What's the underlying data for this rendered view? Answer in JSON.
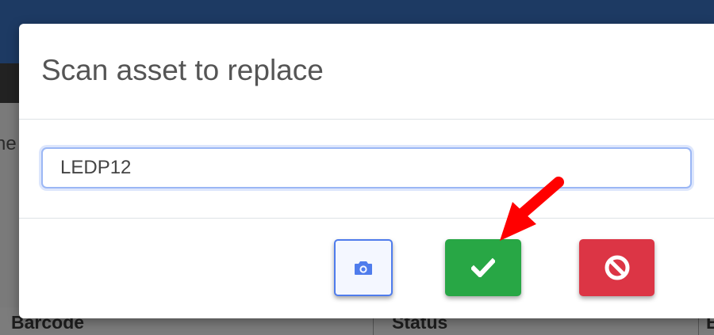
{
  "background": {
    "fragment_text": "ne",
    "table_headers": [
      "Barcode",
      "Status",
      "B"
    ]
  },
  "modal": {
    "title": "Scan asset to replace",
    "input": {
      "value": "LEDP12",
      "placeholder": ""
    },
    "buttons": {
      "camera_icon": "camera-icon",
      "confirm_icon": "check-icon",
      "cancel_icon": "ban-icon"
    }
  },
  "annotation": {
    "arrow_color": "#ff0000"
  },
  "colors": {
    "confirm": "#28a745",
    "cancel": "#dc3545",
    "camera_border": "#4f7cec",
    "header_bar": "#1d3a63"
  }
}
